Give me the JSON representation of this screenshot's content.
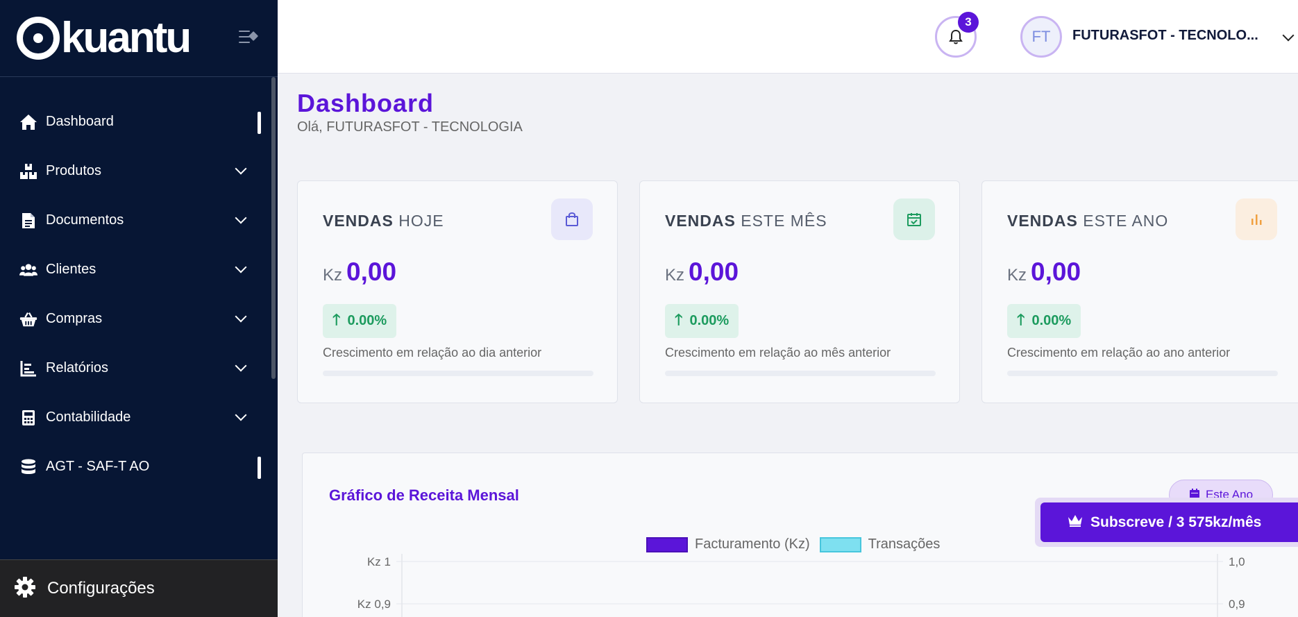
{
  "brand": {
    "name": "kuantu"
  },
  "sidebar": {
    "items": [
      {
        "label": "Dashboard",
        "icon": "home-icon",
        "active": true,
        "expandable": false
      },
      {
        "label": "Produtos",
        "icon": "boxes-icon",
        "expandable": true
      },
      {
        "label": "Documentos",
        "icon": "document-icon",
        "expandable": true
      },
      {
        "label": "Clientes",
        "icon": "users-icon",
        "expandable": true
      },
      {
        "label": "Compras",
        "icon": "basket-icon",
        "expandable": true
      },
      {
        "label": "Relatórios",
        "icon": "bar-chart-icon",
        "expandable": true
      },
      {
        "label": "Contabilidade",
        "icon": "calculator-icon",
        "expandable": true
      },
      {
        "label": "AGT - SAF-T AO",
        "icon": "database-icon",
        "active": true,
        "expandable": false
      }
    ],
    "settings_label": "Configurações"
  },
  "header": {
    "notifications_count": "3",
    "avatar_initials": "FT",
    "company_name": "FUTURASFOT - TECNOLO..."
  },
  "page": {
    "title": "Dashboard",
    "subtitle": "Olá, FUTURASFOT - TECNOLOGIA"
  },
  "cards": [
    {
      "title_bold": "VENDAS",
      "title_rest": "HOJE",
      "currency": "Kz",
      "value": "0,00",
      "growth": "0.00%",
      "description": "Crescimento em relação ao dia anterior",
      "icon": "shopping-bag-icon",
      "icon_bg": "#e8e8fa",
      "icon_color": "#5a5ad6"
    },
    {
      "title_bold": "VENDAS",
      "title_rest": "ESTE MÊS",
      "currency": "Kz",
      "value": "0,00",
      "growth": "0.00%",
      "description": "Crescimento em relação ao mês anterior",
      "icon": "calendar-check-icon",
      "icon_bg": "#dcf1e9",
      "icon_color": "#1c9b5e"
    },
    {
      "title_bold": "VENDAS",
      "title_rest": "ESTE ANO",
      "currency": "Kz",
      "value": "0,00",
      "growth": "0.00%",
      "description": "Crescimento em relação ao ano anterior",
      "icon": "bar-chart-icon",
      "icon_bg": "#fbeee0",
      "icon_color": "#f0a040"
    }
  ],
  "chart": {
    "title": "Gráfico de Receita Mensal",
    "period_label": "Este Ano"
  },
  "chart_data": {
    "type": "bar",
    "title": "Gráfico de Receita Mensal",
    "series": [
      {
        "name": "Facturamento (Kz)",
        "color": "#5b15d9",
        "values": []
      },
      {
        "name": "Transações",
        "color": "#7ee0f0",
        "values": []
      }
    ],
    "left_axis_ticks": [
      "Kz 1",
      "Kz 0,9"
    ],
    "right_axis_ticks": [
      "1,0",
      "0,9"
    ],
    "ylim": [
      0,
      1
    ],
    "legend_position": "top-center",
    "grid": true
  },
  "subscribe": {
    "label": "Subscreve / 3 575kz/mês"
  },
  "colors": {
    "accent": "#5b15d9",
    "sidebar_bg": "#071634",
    "success": "#1c9b5e"
  }
}
